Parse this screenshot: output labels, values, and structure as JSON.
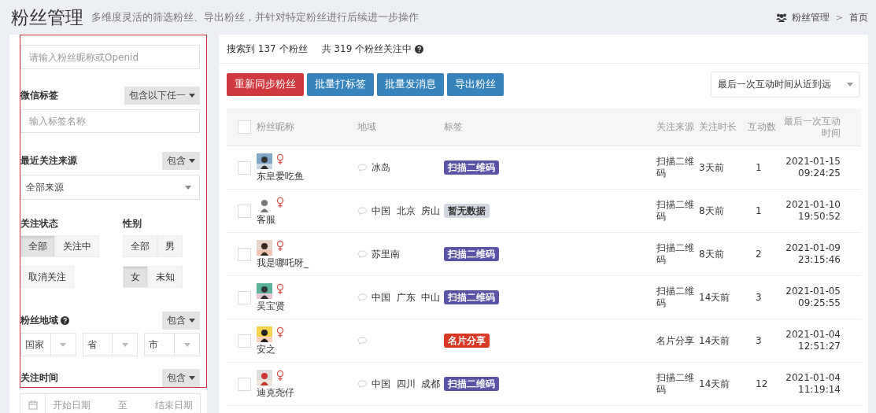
{
  "header": {
    "title": "粉丝管理",
    "subtitle": "多维度灵活的筛选粉丝、导出粉丝，并针对特定粉丝进行后续进一步操作",
    "breadcrumb": [
      "粉丝管理",
      "首页"
    ],
    "breadcrumb_separator": ">"
  },
  "filters": {
    "search": {
      "placeholder": "请输入粉丝昵称或Openid"
    },
    "wechat_tag": {
      "label": "微信标签",
      "mode": "包含以下任一",
      "placeholder": "输入标签名称"
    },
    "source": {
      "label": "最近关注来源",
      "mode": "包含",
      "value": "全部来源"
    },
    "follow_status": {
      "label": "关注状态",
      "options": [
        {
          "label": "全部",
          "selected": true
        },
        {
          "label": "关注中",
          "selected": false
        },
        {
          "label": "取消关注",
          "selected": false
        }
      ]
    },
    "gender": {
      "label": "性别",
      "options": [
        {
          "label": "全部",
          "selected": false
        },
        {
          "label": "男",
          "selected": false
        },
        {
          "label": "女",
          "selected": true
        },
        {
          "label": "未知",
          "selected": false
        }
      ]
    },
    "region": {
      "label": "粉丝地域",
      "mode": "包含",
      "selects": [
        "国家",
        "省",
        "市"
      ]
    },
    "follow_time": {
      "label": "关注时间",
      "mode": "包含",
      "start": "开始日期",
      "to": "至",
      "end": "结束日期"
    }
  },
  "summary": {
    "found": "搜索到 137 个粉丝",
    "total": "共 319 个粉丝关注中"
  },
  "actions": [
    {
      "label": "重新同步粉丝",
      "kind": "danger"
    },
    {
      "label": "批量打标签",
      "kind": "primary"
    },
    {
      "label": "批量发消息",
      "kind": "primary"
    },
    {
      "label": "导出粉丝",
      "kind": "primary"
    }
  ],
  "sort": {
    "value": "最后一次互动时间从近到远"
  },
  "table": {
    "all_checked": false,
    "columns": [
      "粉丝昵称",
      "地域",
      "标签",
      "关注来源",
      "关注时长",
      "互动数",
      "最后一次互动时间"
    ],
    "rows": [
      {
        "name": "东皇爱吃鱼",
        "checked": false,
        "female": true,
        "region": "冰岛",
        "tag": "扫描二维码",
        "color": "#5b53a6",
        "source": "扫描二维码",
        "duration": "3天前",
        "count": "1",
        "time": "2021-01-15 09:24:25"
      },
      {
        "name": "客服",
        "checked": false,
        "female": true,
        "region": "中国  北京  房山",
        "tag": "暂无数据",
        "color": "#d2d6de",
        "source": "扫描二维码",
        "duration": "8天前",
        "count": "1",
        "time": "2021-01-10 19:50:52"
      },
      {
        "name": "我是哪吒呀_",
        "checked": false,
        "female": true,
        "region": "苏里南",
        "tag": "扫描二维码",
        "color": "#5b53a6",
        "source": "扫描二维码",
        "duration": "8天前",
        "count": "2",
        "time": "2021-01-09 23:15:46"
      },
      {
        "name": "吴宝贤",
        "checked": false,
        "female": true,
        "region": "中国  广东  中山",
        "tag": "扫描二维码",
        "color": "#5b53a6",
        "source": "扫描二维码",
        "duration": "14天前",
        "count": "3",
        "time": "2021-01-05 09:25:55"
      },
      {
        "name": "安之",
        "checked": false,
        "female": true,
        "tag": "名片分享",
        "color": "#d73925",
        "source": "名片分享",
        "duration": "14天前",
        "count": "3",
        "time": "2021-01-04 12:51:27"
      },
      {
        "name": "迪克尧仔",
        "checked": false,
        "female": true,
        "region": "中国  四川  成都",
        "tag": "扫描二维码",
        "color": "#5b53a6",
        "source": "扫描二维码",
        "duration": "14天前",
        "count": "12",
        "time": "2021-01-04 11:19:14"
      }
    ]
  }
}
